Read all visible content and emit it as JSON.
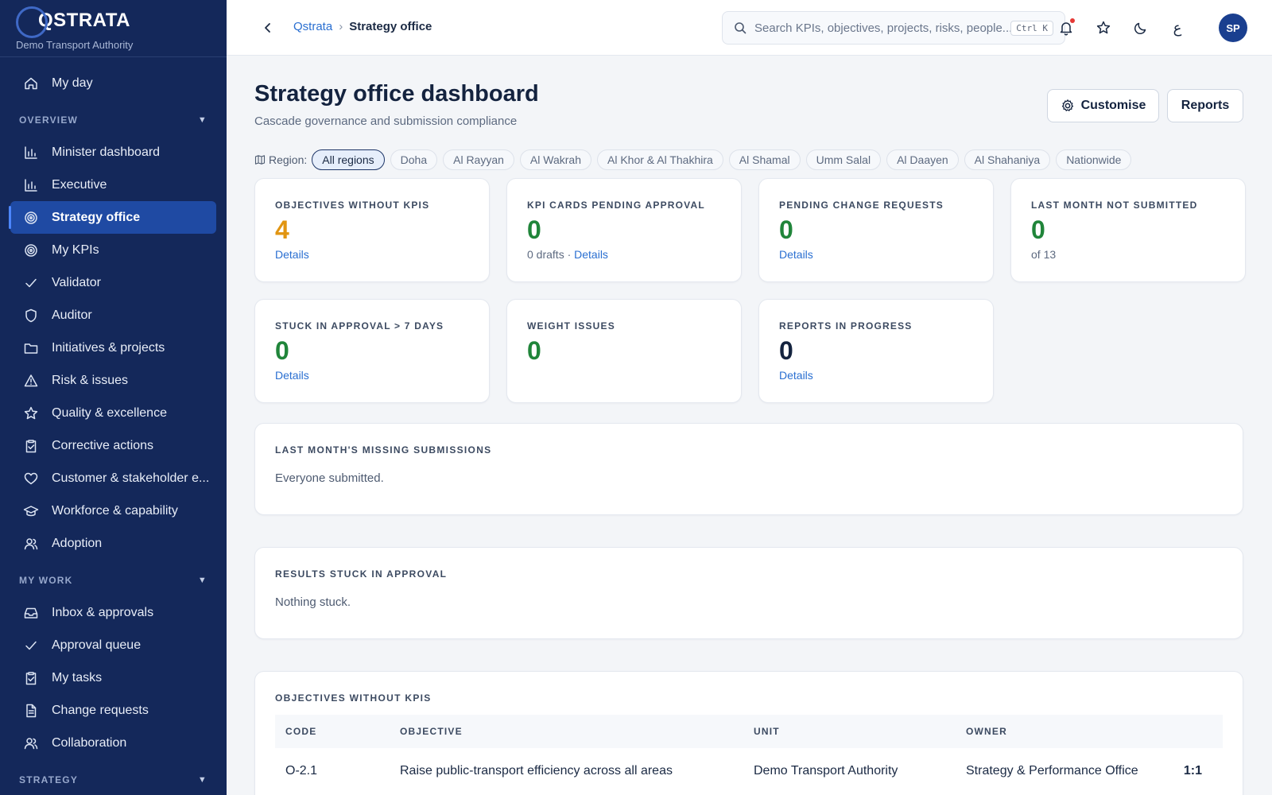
{
  "brand": {
    "name": "QSTRATA",
    "org": "Demo Transport Authority"
  },
  "sidebar": {
    "top_item": {
      "label": "My day",
      "icon": "home-icon"
    },
    "sections": [
      {
        "title": "OVERVIEW",
        "items": [
          {
            "label": "Minister dashboard",
            "icon": "bar-chart-icon"
          },
          {
            "label": "Executive",
            "icon": "bar-chart-icon"
          },
          {
            "label": "Strategy office",
            "icon": "target-icon",
            "active": true
          },
          {
            "label": "My KPIs",
            "icon": "target-icon"
          },
          {
            "label": "Validator",
            "icon": "check-icon"
          },
          {
            "label": "Auditor",
            "icon": "shield-icon"
          },
          {
            "label": "Initiatives & projects",
            "icon": "folder-icon"
          },
          {
            "label": "Risk & issues",
            "icon": "warning-icon"
          },
          {
            "label": "Quality & excellence",
            "icon": "star-icon"
          },
          {
            "label": "Corrective actions",
            "icon": "clipboard-check-icon"
          },
          {
            "label": "Customer & stakeholder e...",
            "icon": "heart-icon"
          },
          {
            "label": "Workforce & capability",
            "icon": "graduation-cap-icon"
          },
          {
            "label": "Adoption",
            "icon": "users-icon"
          }
        ]
      },
      {
        "title": "MY WORK",
        "items": [
          {
            "label": "Inbox & approvals",
            "icon": "inbox-icon"
          },
          {
            "label": "Approval queue",
            "icon": "check-icon"
          },
          {
            "label": "My tasks",
            "icon": "clipboard-check-icon"
          },
          {
            "label": "Change requests",
            "icon": "document-icon"
          },
          {
            "label": "Collaboration",
            "icon": "users-icon"
          }
        ]
      },
      {
        "title": "STRATEGY",
        "items": []
      }
    ]
  },
  "topbar": {
    "breadcrumb": {
      "root": "Qstrata",
      "separator": "›",
      "current": "Strategy office"
    },
    "search": {
      "placeholder": "Search KPIs, objectives, projects, risks, people...",
      "shortcut": "Ctrl K"
    },
    "language_toggle": "ع",
    "avatar_initials": "SP"
  },
  "page": {
    "title": "Strategy office dashboard",
    "subtitle": "Cascade governance and submission compliance",
    "customise_label": "Customise",
    "reports_label": "Reports"
  },
  "region_filter": {
    "label": "Region:",
    "options": [
      "All regions",
      "Doha",
      "Al Rayyan",
      "Al Wakrah",
      "Al Khor & Al Thakhira",
      "Al Shamal",
      "Umm Salal",
      "Al Daayen",
      "Al Shahaniya",
      "Nationwide"
    ],
    "selected": "All regions"
  },
  "kpis": [
    {
      "label": "OBJECTIVES WITHOUT KPIS",
      "value": "4",
      "tone": "orange",
      "foot_prefix": "",
      "foot_link": "Details"
    },
    {
      "label": "KPI CARDS PENDING APPROVAL",
      "value": "0",
      "tone": "green",
      "foot_prefix": "0 drafts · ",
      "foot_link": "Details"
    },
    {
      "label": "PENDING CHANGE REQUESTS",
      "value": "0",
      "tone": "green",
      "foot_prefix": "",
      "foot_link": "Details"
    },
    {
      "label": "LAST MONTH NOT SUBMITTED",
      "value": "0",
      "tone": "green",
      "foot_prefix": "of 13",
      "foot_link": ""
    },
    {
      "label": "STUCK IN APPROVAL > 7 DAYS",
      "value": "0",
      "tone": "green",
      "foot_prefix": "",
      "foot_link": "Details"
    },
    {
      "label": "WEIGHT ISSUES",
      "value": "0",
      "tone": "green",
      "foot_prefix": "",
      "foot_link": ""
    },
    {
      "label": "REPORTS IN PROGRESS",
      "value": "0",
      "tone": "dark",
      "foot_prefix": "",
      "foot_link": "Details"
    }
  ],
  "missing_submissions": {
    "title": "LAST MONTH'S MISSING SUBMISSIONS",
    "text": "Everyone submitted."
  },
  "stuck_results": {
    "title": "RESULTS STUCK IN APPROVAL",
    "text": "Nothing stuck."
  },
  "objectives_table": {
    "title": "OBJECTIVES WITHOUT KPIS",
    "columns": [
      "CODE",
      "OBJECTIVE",
      "UNIT",
      "OWNER",
      ""
    ],
    "rows": [
      [
        "O-2.1",
        "Raise public-transport efficiency across all areas",
        "Demo Transport Authority",
        "Strategy & Performance Office",
        "1:1"
      ]
    ]
  },
  "colors": {
    "sidebar_bg": "#14285a",
    "active_bg": "#1f4aa3",
    "link": "#2a6fd1",
    "orange": "#e19512",
    "green": "#20853a"
  }
}
